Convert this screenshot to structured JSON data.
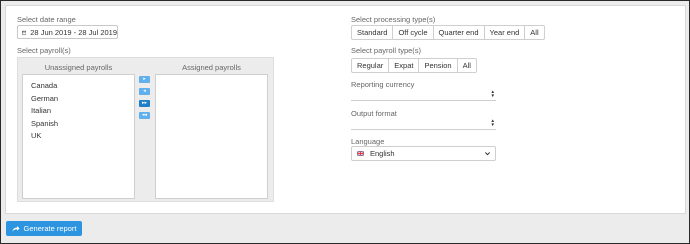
{
  "date_range": {
    "label": "Select date range",
    "value": "28 Jun 2019 - 28 Jul 2019",
    "icon": "calendar-icon"
  },
  "payrolls": {
    "label": "Select payroll(s)",
    "unassigned_header": "Unassigned payrolls",
    "assigned_header": "Assigned payrolls",
    "unassigned": [
      "Canada",
      "German",
      "Italian",
      "Spanish",
      "UK"
    ],
    "assigned": [],
    "controls": {
      "add_one": "▸",
      "remove_one": "◂",
      "add_all": "▸▸",
      "remove_all": "◂◂"
    }
  },
  "processing_type": {
    "label": "Select processing type(s)",
    "options": [
      "Standard",
      "Off cycle",
      "Quarter end",
      "Year end",
      "All"
    ]
  },
  "payroll_type": {
    "label": "Select payroll type(s)",
    "options": [
      "Regular",
      "Expat",
      "Pension",
      "All"
    ]
  },
  "reporting_currency": {
    "label": "Reporting currency",
    "value": ""
  },
  "output_format": {
    "label": "Output format",
    "value": ""
  },
  "language": {
    "label": "Language",
    "value": "English",
    "flag_icon": "uk-flag-icon"
  },
  "generate_button": {
    "label": "Generate report",
    "icon": "share-arrow-icon"
  },
  "colors": {
    "accent": "#2d95e0",
    "arrow_light": "#5fb0ec",
    "arrow_dark": "#1f7fc7"
  }
}
